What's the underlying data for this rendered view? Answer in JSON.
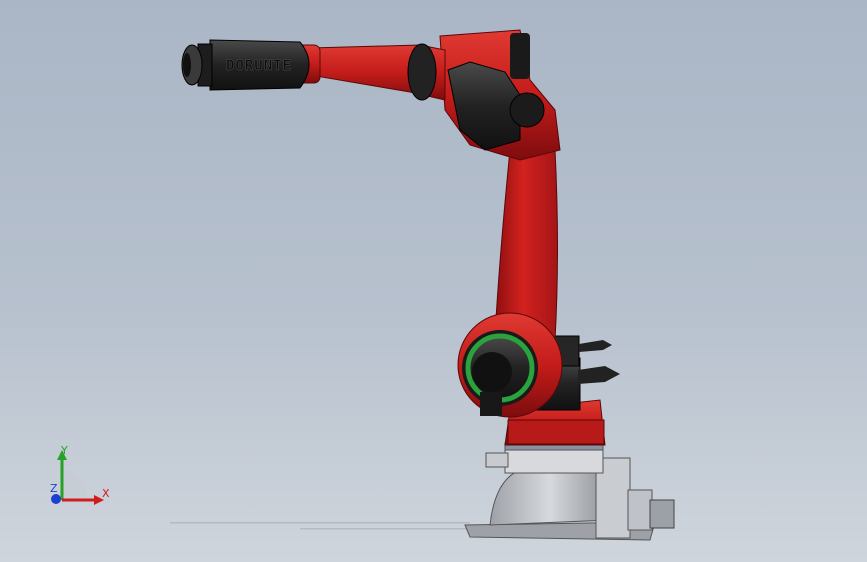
{
  "robot": {
    "brand_label": "DORUNTE",
    "body_color": "#c01a1a",
    "shadow_color": "#8e0e10",
    "cover_color": "#1f1f1f",
    "gear_color": "#2aa33c",
    "base_color": "#b9bcc2"
  },
  "triad": {
    "x_label": "X",
    "y_label": "Y",
    "z_label": "Z",
    "x_color": "#d01c1c",
    "y_color": "#27a127",
    "z_color": "#1f3fd0"
  }
}
